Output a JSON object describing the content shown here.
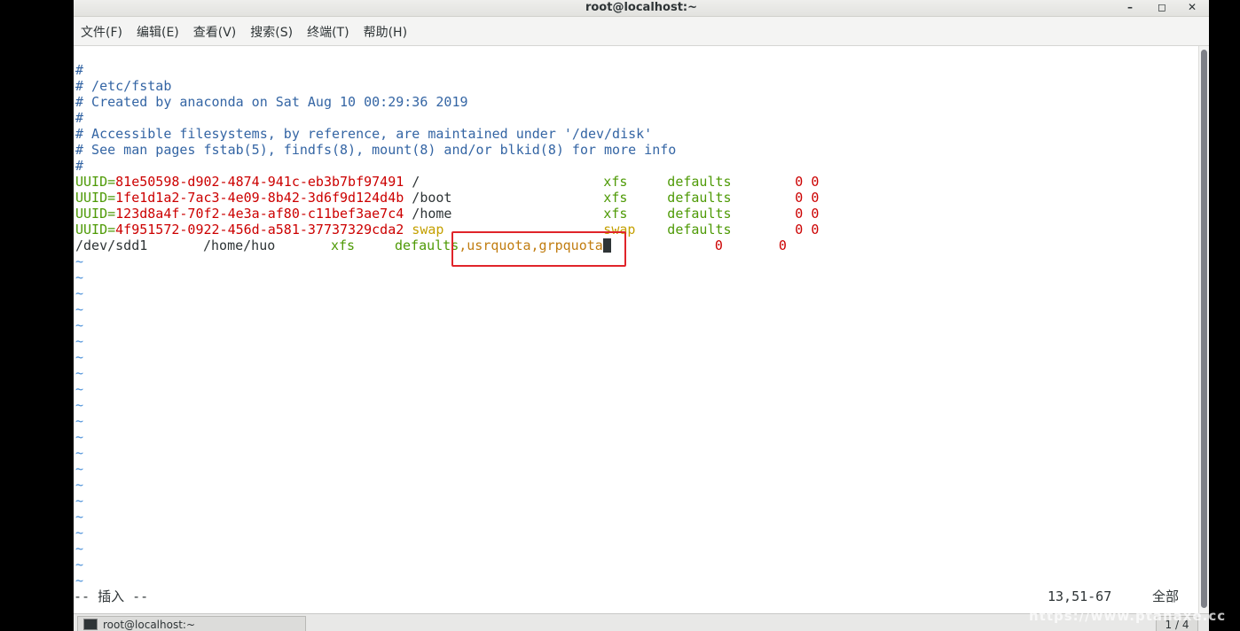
{
  "window": {
    "title": "root@localhost:~"
  },
  "controls": {
    "minimize": "–",
    "maximize": "◻",
    "close": "✕"
  },
  "menu": [
    "文件(F)",
    "编辑(E)",
    "查看(V)",
    "搜索(S)",
    "终端(T)",
    "帮助(H)"
  ],
  "comments": [
    "#",
    "# /etc/fstab",
    "# Created by anaconda on Sat Aug 10 00:29:36 2019",
    "#",
    "# Accessible filesystems, by reference, are maintained under '/dev/disk'",
    "# See man pages fstab(5), findfs(8), mount(8) and/or blkid(8) for more info",
    "#"
  ],
  "entries": [
    {
      "key": "UUID=",
      "id": "81e50598-d902-4874-941c-eb3b7bf97491",
      "mount": "/",
      "type": "xfs",
      "options": "defaults",
      "dump": "0",
      "pass": "0"
    },
    {
      "key": "UUID=",
      "id": "1fe1d1a2-7ac3-4e09-8b42-3d6f9d124d4b",
      "mount": "/boot",
      "type": "xfs",
      "options": "defaults",
      "dump": "0",
      "pass": "0"
    },
    {
      "key": "UUID=",
      "id": "123d8a4f-70f2-4e3a-af80-c11bef3ae7c4",
      "mount": "/home",
      "type": "xfs",
      "options": "defaults",
      "dump": "0",
      "pass": "0"
    },
    {
      "key": "UUID=",
      "id": "4f951572-0922-456d-a581-37737329cda2",
      "mount": "swap",
      "type": "swap",
      "options": "defaults",
      "dump": "0",
      "pass": "0"
    }
  ],
  "edited_line": {
    "device": "/dev/sdd1",
    "mount": "/home/huo",
    "type": "xfs",
    "options_base": "defaults",
    "options_added": ",usrquota,grpquota",
    "dump": "0",
    "pass": "0"
  },
  "tilde": "~",
  "status": {
    "mode": "-- 插入 --",
    "position": "13,51-67",
    "scope": "全部"
  },
  "taskbar": {
    "item": "root@localhost:~",
    "pager": "1 / 4"
  },
  "watermark": "https://www.ptanaxe.cc"
}
